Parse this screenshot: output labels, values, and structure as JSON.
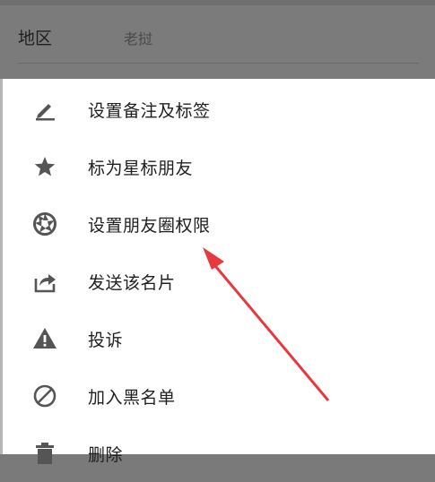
{
  "header": {
    "label": "地区",
    "value": "老挝"
  },
  "menu": {
    "items": [
      {
        "label": "设置备注及标签",
        "icon": "pencil-icon"
      },
      {
        "label": "标为星标朋友",
        "icon": "star-icon"
      },
      {
        "label": "设置朋友圈权限",
        "icon": "aperture-icon"
      },
      {
        "label": "发送该名片",
        "icon": "share-icon"
      },
      {
        "label": "投诉",
        "icon": "warning-icon"
      },
      {
        "label": "加入黑名单",
        "icon": "block-icon"
      },
      {
        "label": "删除",
        "icon": "trash-icon"
      }
    ]
  },
  "colors": {
    "icon": "#555555",
    "arrow": "#e8383d",
    "overlay": "#7b7b7b"
  }
}
